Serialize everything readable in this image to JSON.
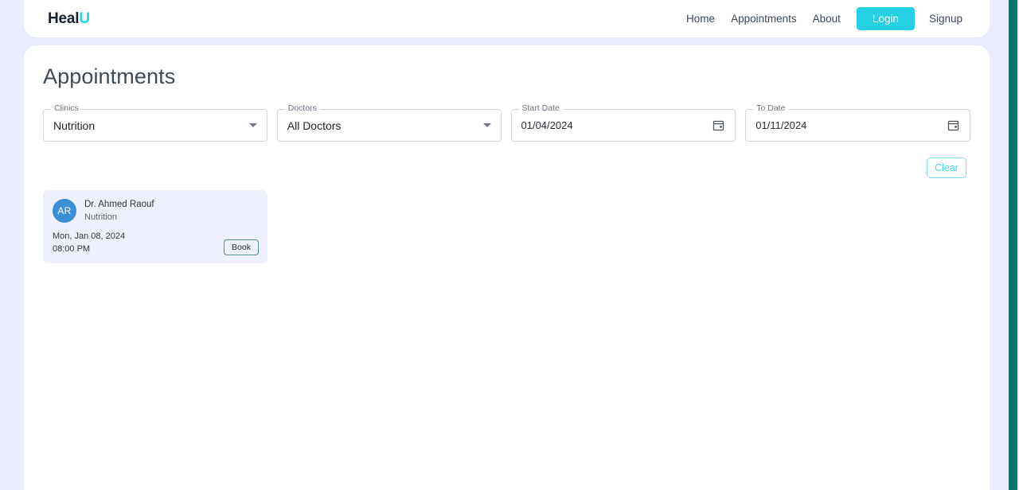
{
  "header": {
    "brand_main": "Heal",
    "brand_accent": "U",
    "nav": [
      {
        "label": "Home"
      },
      {
        "label": "Appointments"
      },
      {
        "label": "About"
      }
    ],
    "login_label": "Login",
    "signup_label": "Signup",
    "login_bg": "#25d0e3",
    "accent_color": "#22d3ee"
  },
  "main": {
    "title": "Appointments"
  },
  "filters": {
    "clinics": {
      "label": "Clinics",
      "value": "Nutrition",
      "icon": "chevron-down-icon"
    },
    "doctors": {
      "label": "Doctors",
      "value": "All Doctors",
      "icon": "chevron-down-icon"
    },
    "start_date": {
      "label": "Start Date",
      "value": "01/04/2024",
      "icon": "calendar-icon"
    },
    "to_date": {
      "label": "To Date",
      "value": "01/11/2024",
      "icon": "calendar-icon"
    },
    "clear_label": "Clear",
    "clear_color": "#44d7e8"
  },
  "appointments": [
    {
      "initials": "AR",
      "doctor": "Dr. Ahmed Raouf",
      "specialty": "Nutrition",
      "date": "Mon, Jan 08, 2024",
      "time": "08:00 PM",
      "book_label": "Book",
      "avatar_color": "#3b8fd4",
      "card_bg": "#eef0fb"
    }
  ],
  "scrollbar": {
    "thumb_color": "#03796e"
  },
  "page": {
    "background": "#e9ecfd",
    "panel_background": "#ffffff"
  }
}
